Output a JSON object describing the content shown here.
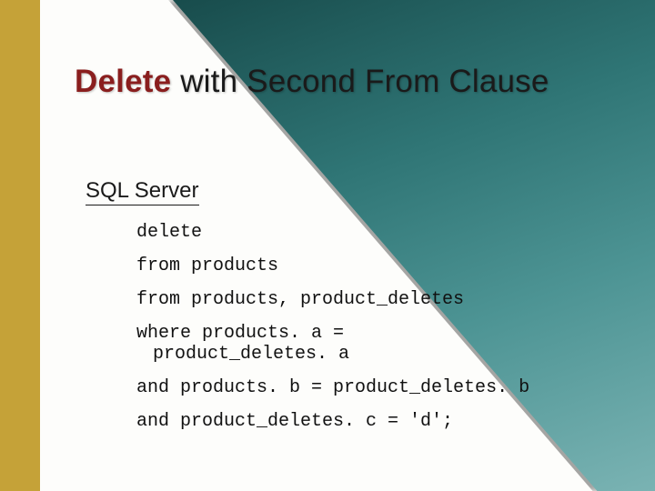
{
  "title": {
    "emph": "Delete",
    "rest": " with Second From Clause"
  },
  "subtitle": "SQL Server",
  "code": {
    "l1": "delete",
    "l2": "from products",
    "l3": "from products, product_deletes",
    "l4a": "where products. a =",
    "l4b": "product_deletes. a",
    "l5": "and products. b = product_deletes. b",
    "l6": "and product_deletes. c = 'd';"
  }
}
